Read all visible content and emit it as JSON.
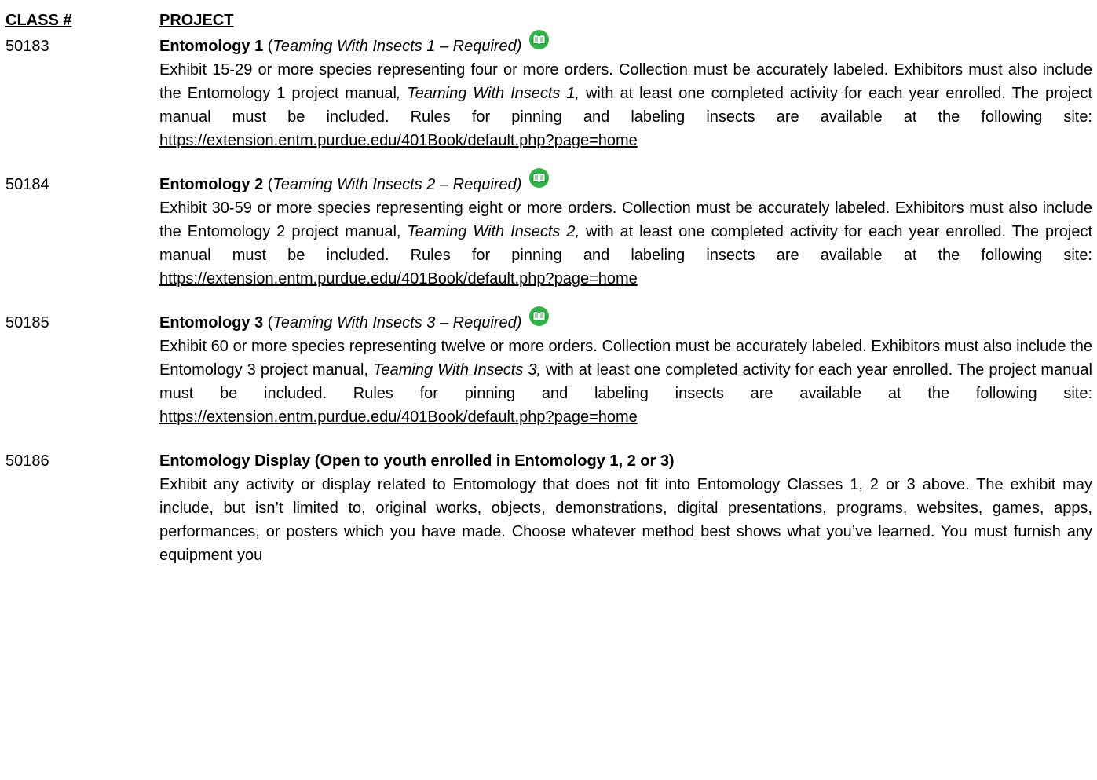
{
  "header": {
    "class_label": "CLASS #",
    "project_label": "PROJECT"
  },
  "entries": [
    {
      "class_num": "50183",
      "title_bold": "Entomology 1",
      "title_open": " (",
      "title_italic": "Teaming With Insects 1 – Required)",
      "has_manual_icon": true,
      "desc_a": "Exhibit 15-29 or more species representing four or more orders. Collection must be accurately labeled. Exhibitors must also include the Entomology 1 project manual",
      "desc_italic": ", Teaming With Insects 1,",
      "desc_b": " with at least one completed activity for each year enrolled. The project manual must be included. Rules for pinning and labeling insects are available at the following site:",
      "url": "https://extension.entm.purdue.edu/401Book/default.php?page=home"
    },
    {
      "class_num": "50184",
      "title_bold": "Entomology 2",
      "title_open": " (",
      "title_italic": "Teaming With Insects 2 – Required)",
      "has_manual_icon": true,
      "desc_a": "Exhibit 30-59 or more species representing eight or more orders. Collection must be accurately labeled. Exhibitors must also include the Entomology 2 project manual, ",
      "desc_italic": "Teaming With Insects 2,",
      "desc_b": " with at least one completed activity for each year enrolled. The project manual must be included. Rules for pinning and labeling insects are available at the following site:",
      "url": "https://extension.entm.purdue.edu/401Book/default.php?page=home"
    },
    {
      "class_num": "50185",
      "title_bold": "Entomology 3",
      "title_open": " (",
      "title_italic": "Teaming With Insects 3 – Required)",
      "has_manual_icon": true,
      "desc_a": "Exhibit 60 or more species representing twelve or more orders. Collection must be accurately labeled. Exhibitors must also include the Entomology 3 project manual, ",
      "desc_italic": "Teaming With Insects 3,",
      "desc_b": " with at least one completed activity for each year enrolled. The project manual must be included. Rules for pinning and labeling insects are available at the following site:",
      "url": "https://extension.entm.purdue.edu/401Book/default.php?page=home"
    },
    {
      "class_num": "50186",
      "title_bold": "Entomology Display (Open to youth enrolled in Entomology 1, 2 or  3)",
      "desc_a": "Exhibit any activity or display related to Entomology that does not fit into Entomology Classes 1, 2 or 3 above. The exhibit may include, but isn’t limited to, original works, objects, demonstrations, digital presentations, programs, websites, games, apps, performances, or posters which you have made. Choose whatever method best shows what you’ve learned. You must furnish any equipment you"
    }
  ],
  "icons": {
    "manual_icon": "green-book-icon",
    "manual_icon_color": "#33b24a"
  }
}
